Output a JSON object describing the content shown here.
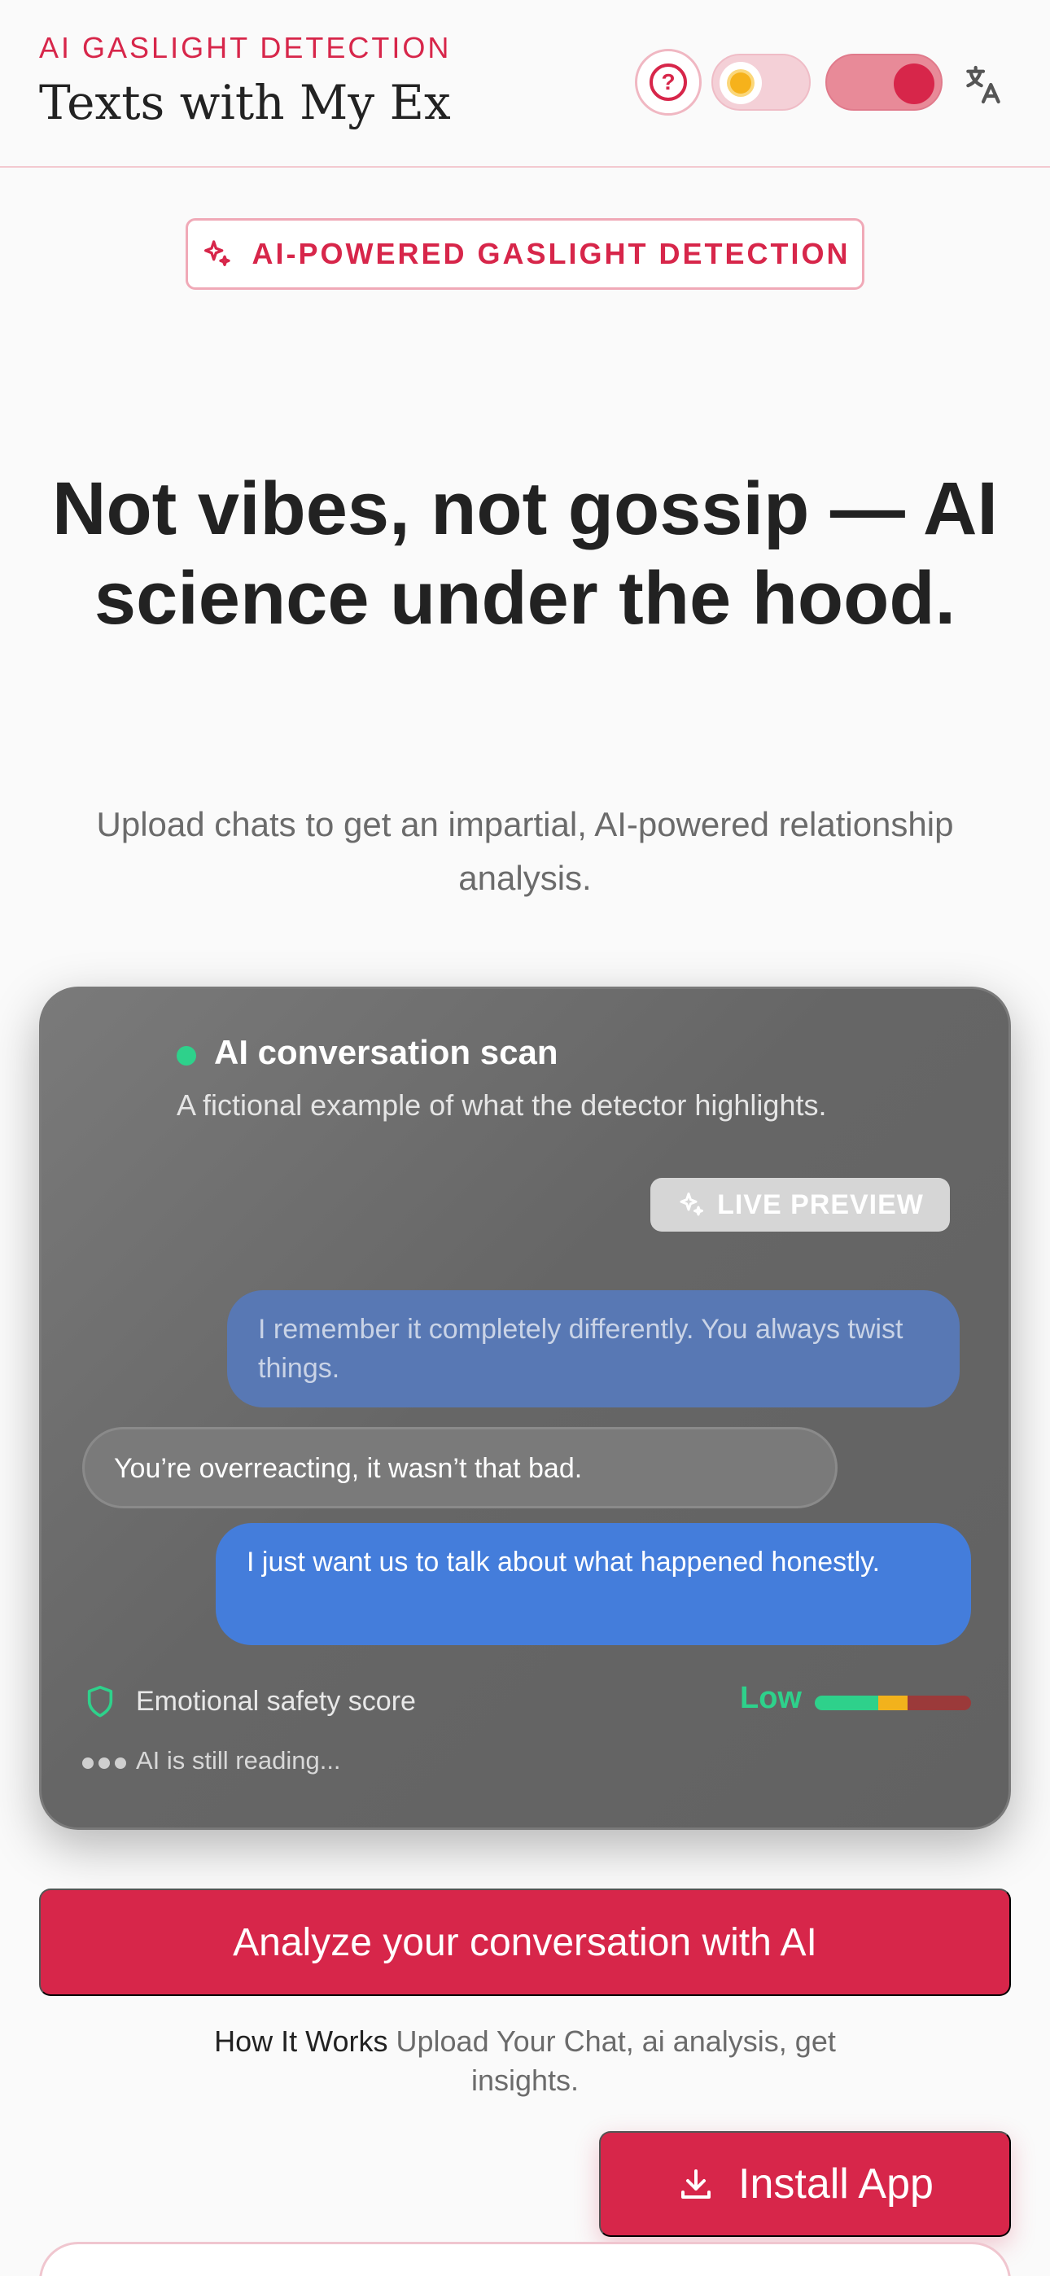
{
  "header": {
    "kicker": "AI GASLIGHT DETECTION",
    "title": "Texts with My Ex",
    "help_symbol": "?",
    "icons": [
      "help-icon",
      "sun-icon",
      "translate-icon"
    ]
  },
  "badge": {
    "label": "AI-POWERED GASLIGHT DETECTION",
    "icon": "sparkles-icon"
  },
  "hero": {
    "title_line1": "Not vibes, not gossip — AI",
    "title_line2": "science under the hood.",
    "subtitle": "Upload chats to get an impartial, AI-powered relationship analysis."
  },
  "preview": {
    "title": "AI conversation scan",
    "description": "A fictional example of what the detector highlights.",
    "live_label": "LIVE PREVIEW",
    "messages": [
      {
        "side": "right",
        "text": "I remember it completely differently. You always twist things."
      },
      {
        "side": "left",
        "text": "You’re overreacting, it wasn’t that bad."
      },
      {
        "side": "right",
        "text": "I just want us to talk about what happened honestly."
      }
    ],
    "safety_label": "Emotional safety score",
    "safety_value": "Low",
    "status": "AI is still reading..."
  },
  "cta": {
    "label": "Analyze your conversation with AI"
  },
  "how": {
    "strong": "How It Works",
    "text": " Upload Your Chat, ai analysis, get insights."
  },
  "install": {
    "label": "Install App",
    "icon": "download-icon"
  },
  "colors": {
    "accent": "#d7264a",
    "safe": "#2ed18b",
    "bubble_blue": "#447ddb"
  }
}
